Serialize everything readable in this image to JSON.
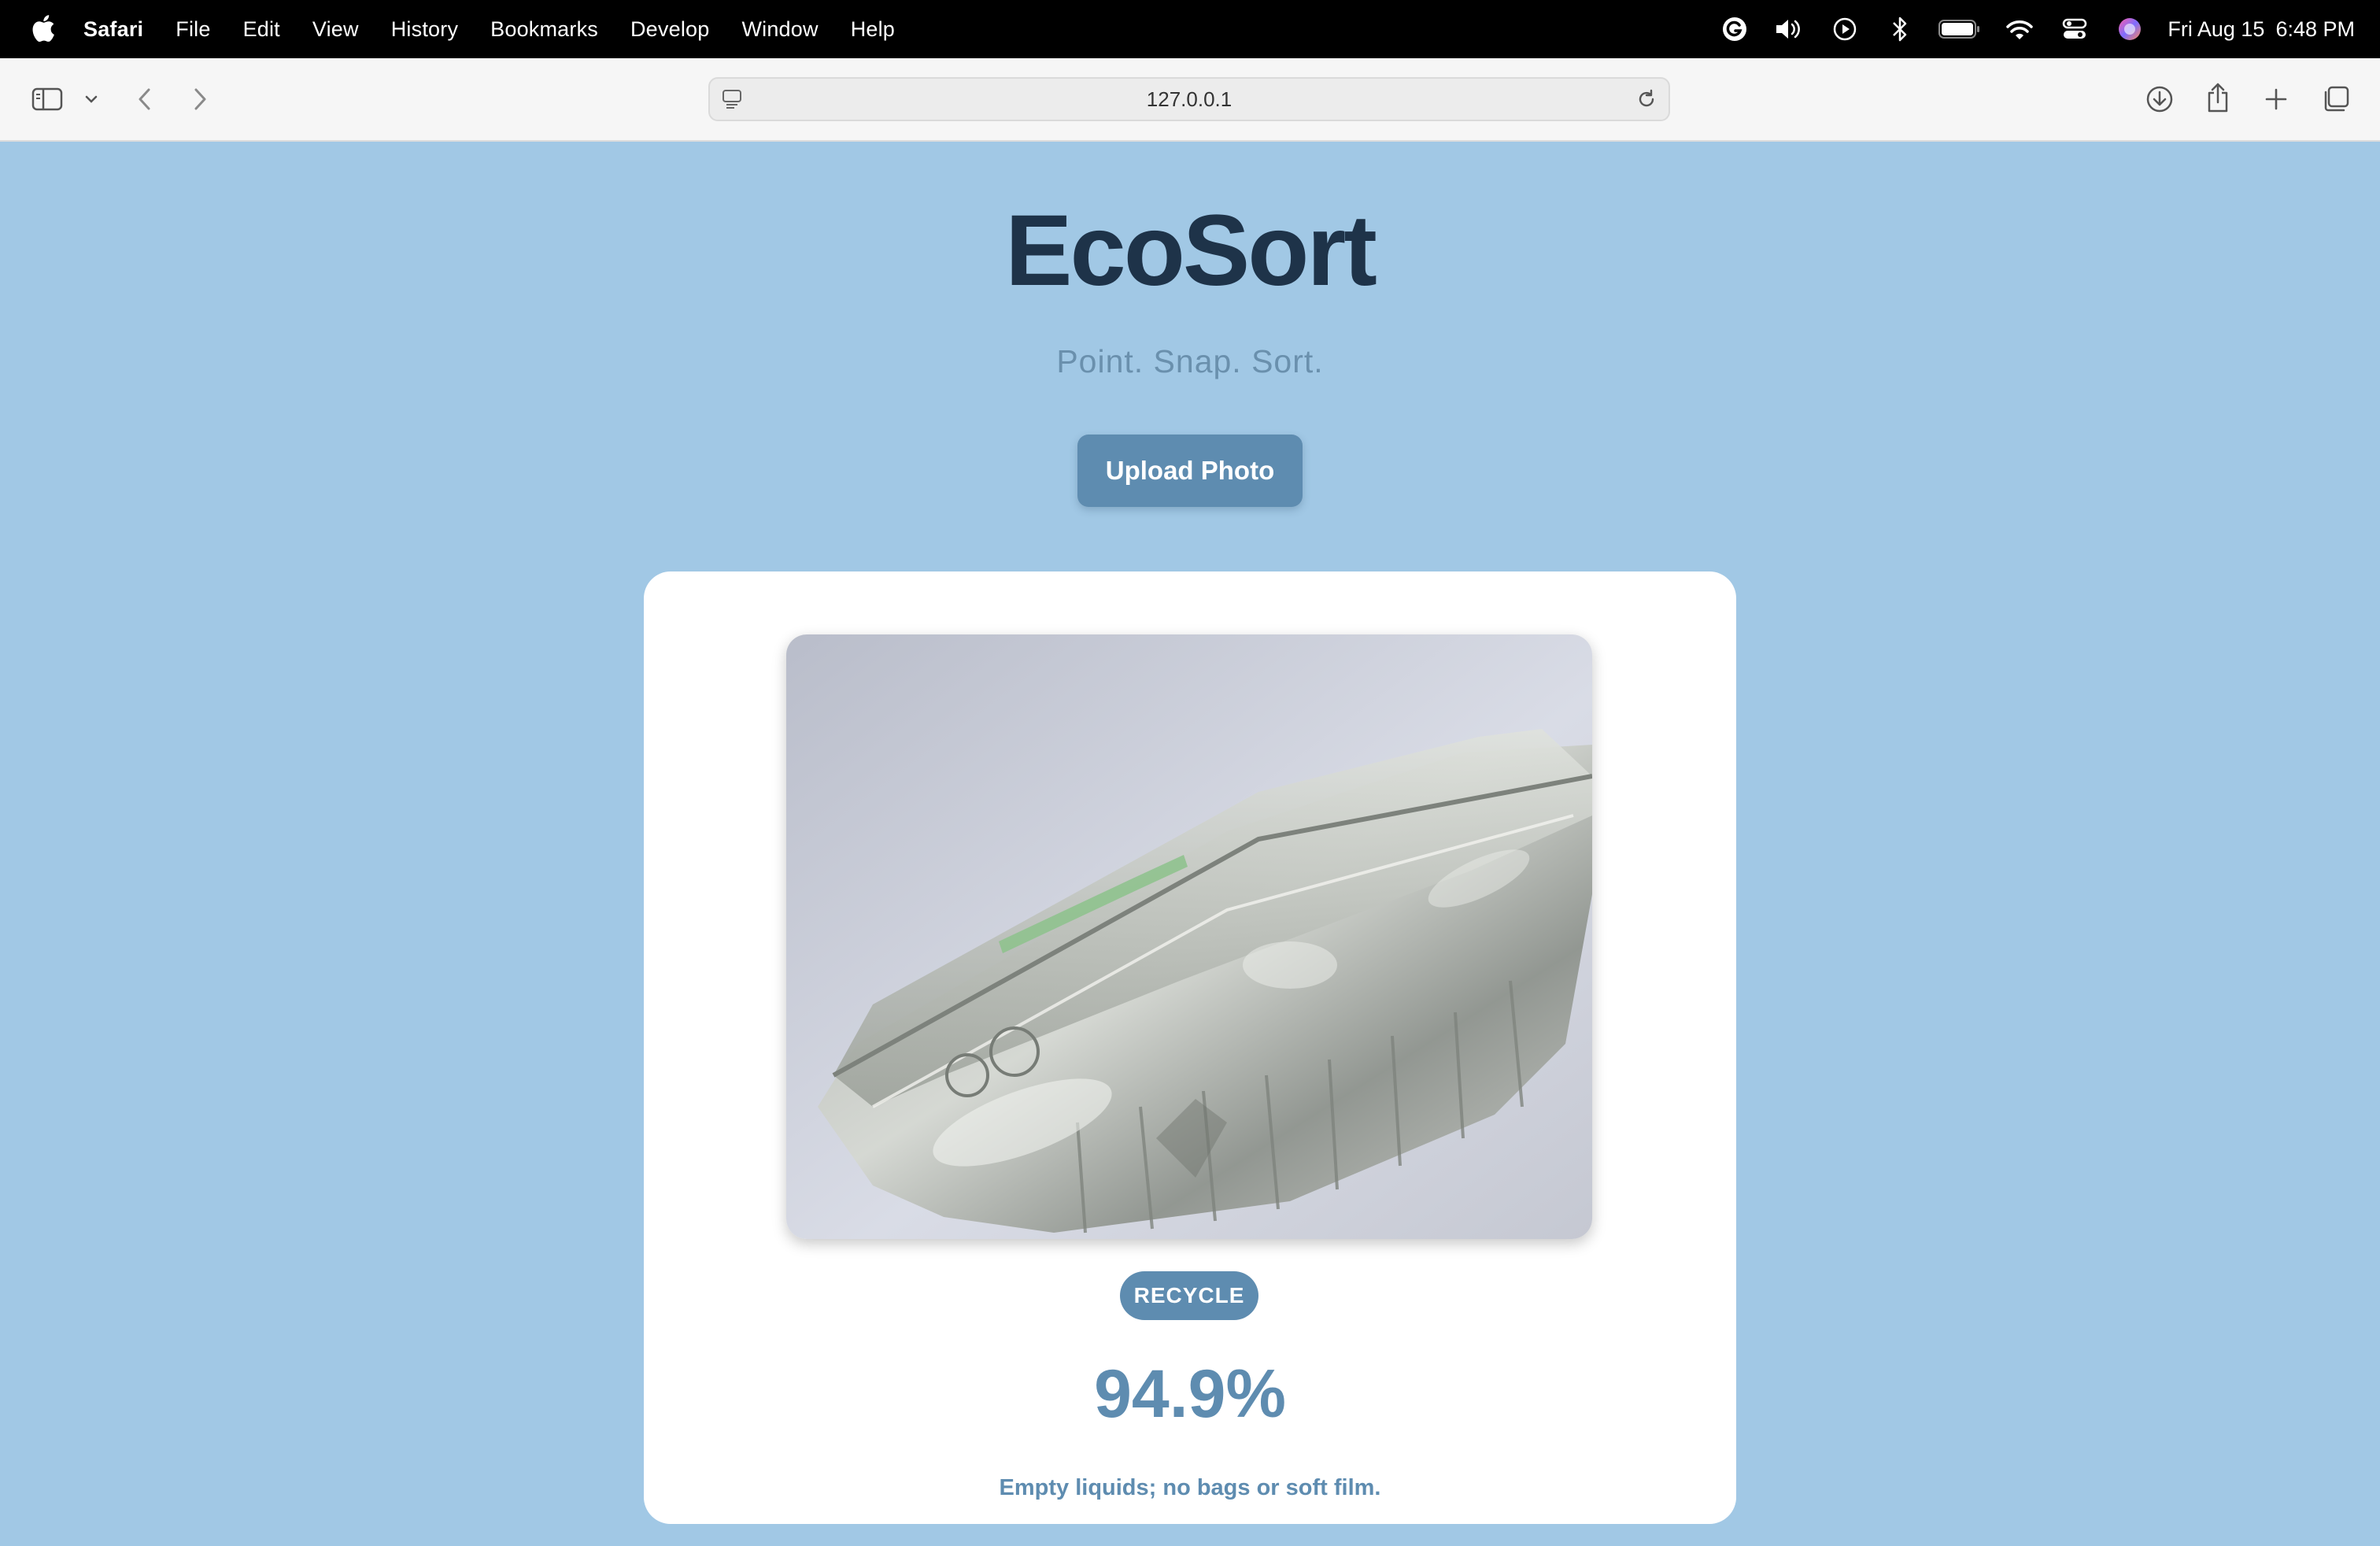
{
  "menubar": {
    "app_name": "Safari",
    "items": [
      "File",
      "Edit",
      "View",
      "History",
      "Bookmarks",
      "Develop",
      "Window",
      "Help"
    ],
    "clock": {
      "date": "Fri Aug 15",
      "time": "6:48 PM"
    },
    "status_icons": [
      "grammarly-icon",
      "volume-icon",
      "play-icon",
      "bluetooth-icon",
      "battery-icon",
      "wifi-icon",
      "control-center-icon",
      "siri-icon"
    ]
  },
  "browser": {
    "url": "127.0.0.1"
  },
  "app": {
    "title": "EcoSort",
    "tagline": "Point. Snap. Sort.",
    "upload_label": "Upload Photo",
    "result": {
      "category": "RECYCLE",
      "confidence": "94.9%",
      "note": "Empty liquids; no bags or soft film."
    }
  },
  "colors": {
    "page_background": "#a1c8e5",
    "accent": "#5e8cb0",
    "title": "#1e3349",
    "card": "#ffffff"
  }
}
